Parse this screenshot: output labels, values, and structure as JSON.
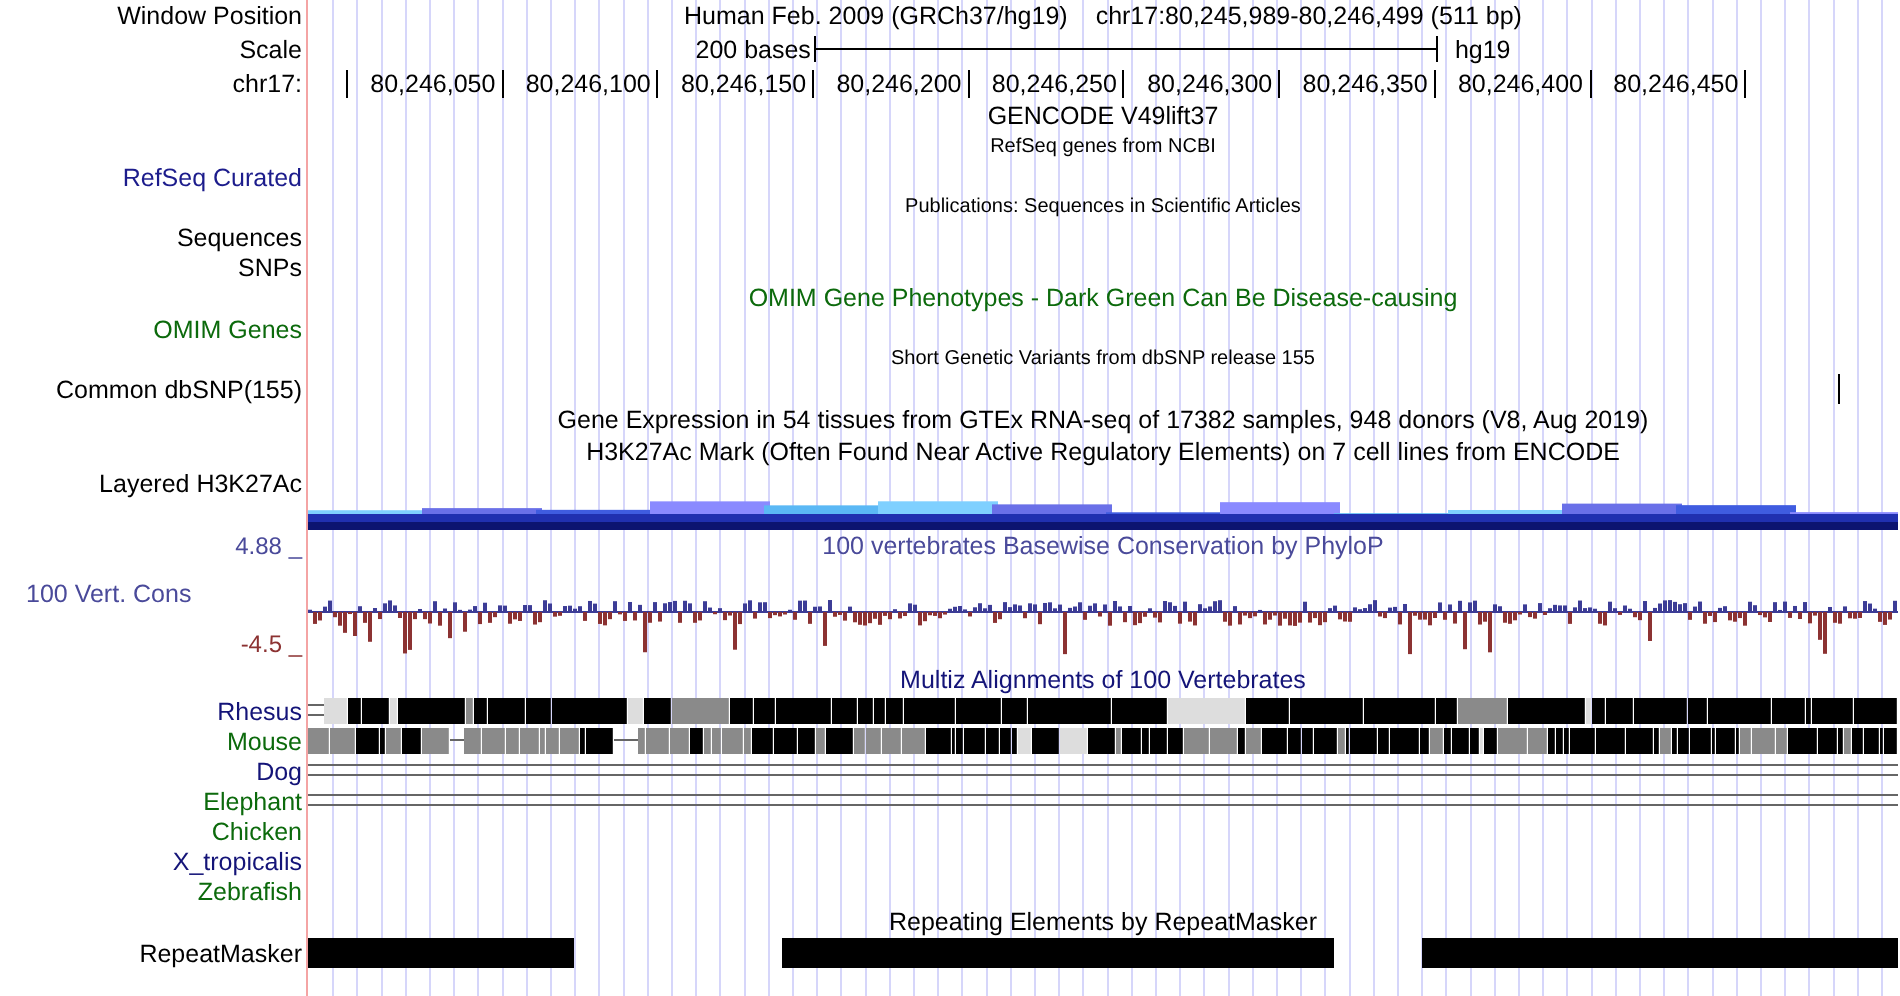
{
  "rows": [
    {
      "kind": "position",
      "label": "Window Position",
      "assembly": "Human Feb. 2009 (GRCh37/hg19)",
      "position": "chr17:80,245,989-80,246,499 (511 bp)"
    },
    {
      "kind": "scale",
      "label": "Scale",
      "bases": "200 bases",
      "build": "hg19"
    },
    {
      "kind": "ruler",
      "label": "chr17:",
      "ticks": [
        "80,246,050",
        "80,246,100",
        "80,246,150",
        "80,246,200",
        "80,246,250",
        "80,246,300",
        "80,246,350",
        "80,246,400",
        "80,246,450"
      ]
    },
    {
      "kind": "title",
      "text": "GENCODE V49lift37",
      "color": "#000000"
    },
    {
      "kind": "small_title",
      "text": "RefSeq genes from NCBI"
    },
    {
      "kind": "label",
      "label": "RefSeq Curated",
      "color": "#1c1c8c"
    },
    {
      "kind": "small_title",
      "text": "Publications: Sequences in Scientific Articles"
    },
    {
      "kind": "label",
      "label": "Sequences",
      "color": "#000000"
    },
    {
      "kind": "label",
      "label": "SNPs",
      "color": "#000000"
    },
    {
      "kind": "title",
      "text": "OMIM Gene Phenotypes - Dark Green Can Be Disease-causing",
      "color": "#0c6a0c"
    },
    {
      "kind": "label",
      "label": "OMIM Genes",
      "color": "#0c6a0c"
    },
    {
      "kind": "small_title",
      "text": "Short Genetic Variants from dbSNP release 155"
    },
    {
      "kind": "density",
      "label": "Common dbSNP(155)",
      "color": "#000000"
    },
    {
      "kind": "title",
      "text": "Gene Expression in 54 tissues from GTEx RNA-seq of 17382 samples, 948 donors (V8, Aug 2019)",
      "color": "#000000"
    },
    {
      "kind": "title",
      "text": "H3K27Ac Mark (Often Found Near Active Regulatory Elements) on 7 cell lines from ENCODE",
      "color": "#000000"
    },
    {
      "kind": "label",
      "label": "Layered H3K27Ac",
      "color": "#000000"
    },
    {
      "kind": "layered"
    },
    {
      "kind": "wiggle_title",
      "max_label": "4.88 _",
      "text": "100 vertebrates Basewise Conservation by PhyloP",
      "color": "#4a4a9a"
    },
    {
      "kind": "wiggle",
      "label": "100 Vert. Cons",
      "min_label": "-4.5 _",
      "color": "#4a4a9a"
    },
    {
      "kind": "title",
      "text": "Multiz Alignments of 100 Vertebrates",
      "color": "#141478"
    },
    {
      "kind": "species_dense",
      "label": "Rhesus",
      "color": "#141478"
    },
    {
      "kind": "species_mixed",
      "label": "Mouse",
      "color": "#0c6a0c"
    },
    {
      "kind": "species_lines",
      "label": "Dog",
      "color": "#141478"
    },
    {
      "kind": "species_lines",
      "label": "Elephant",
      "color": "#0c6a0c"
    },
    {
      "kind": "species",
      "label": "Chicken",
      "color": "#0c6a0c"
    },
    {
      "kind": "species",
      "label": "X_tropicalis",
      "color": "#141478"
    },
    {
      "kind": "species",
      "label": "Zebrafish",
      "color": "#0c6a0c"
    },
    {
      "kind": "title",
      "text": "Repeating Elements by RepeatMasker",
      "color": "#000000"
    },
    {
      "kind": "repeat",
      "label": "RepeatMasker"
    }
  ]
}
